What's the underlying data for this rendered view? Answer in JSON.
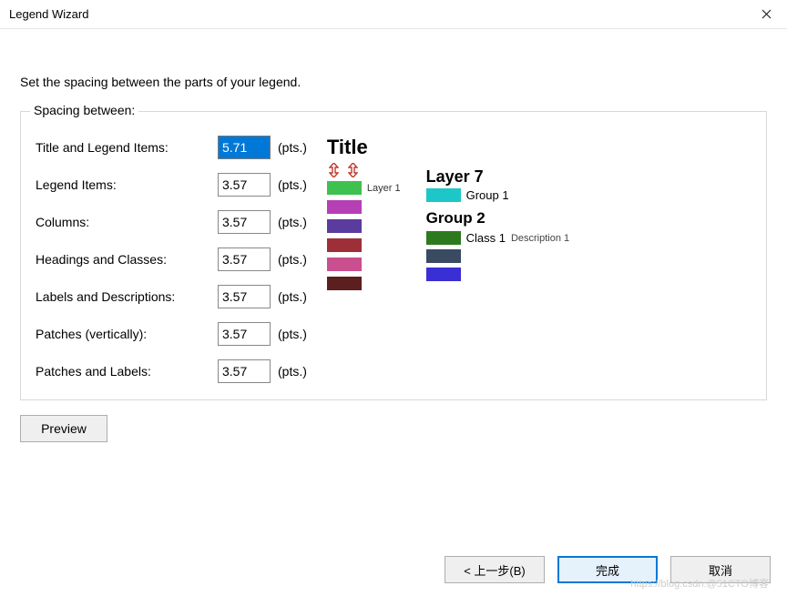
{
  "window": {
    "title": "Legend Wizard"
  },
  "instruction": "Set the spacing between the parts of your legend.",
  "fieldset": {
    "label": "Spacing between:",
    "units": "(pts.)",
    "fields": {
      "title_items": {
        "label": "Title and Legend Items:",
        "value": "5.71"
      },
      "legend_items": {
        "label": "Legend Items:",
        "value": "3.57"
      },
      "columns": {
        "label": "Columns:",
        "value": "3.57"
      },
      "headings": {
        "label": "Headings and Classes:",
        "value": "3.57"
      },
      "labels_desc": {
        "label": "Labels and Descriptions:",
        "value": "3.57"
      },
      "patches_v": {
        "label": "Patches (vertically):",
        "value": "3.57"
      },
      "patches_labels": {
        "label": "Patches and Labels:",
        "value": "3.57"
      }
    }
  },
  "preview": {
    "title": "Title",
    "layer1": "Layer 1",
    "layer7": "Layer 7",
    "group1": "Group 1",
    "group2": "Group 2",
    "class1": "Class 1",
    "desc1": "Description 1"
  },
  "buttons": {
    "preview": "Preview",
    "back": "< 上一步(B)",
    "finish": "完成",
    "cancel": "取消"
  },
  "watermark": "https://blog.csdn.@51CTO博客"
}
